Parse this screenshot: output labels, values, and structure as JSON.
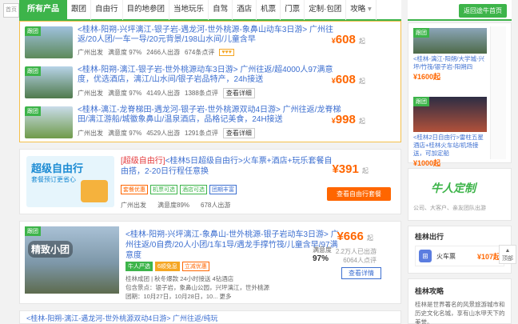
{
  "nav": {
    "side_tag": "首页",
    "all_products": "所有产品",
    "items": [
      "跟团",
      "自由行",
      "目的地参团",
      "当地玩乐",
      "自驾",
      "酒店",
      "机票",
      "门票",
      "定制·包团",
      "攻略"
    ],
    "back_home": "返回途牛首页"
  },
  "packages": [
    {
      "tag": "跟团",
      "title": "<桂林-阳朔-兴坪漓江-银子岩-遇龙河-世外桃源-象鼻山动车3日游> 广州往返/20人团/一车一导/20元背景/198山水间/儿童含早",
      "origin": "广州出发",
      "satisfaction": "满意度 97%",
      "signups": "2466人出游",
      "reviews": "674条点评",
      "detail": "查看详细",
      "price": "608",
      "qi": "起"
    },
    {
      "tag": "跟团",
      "title": "<桂林-阳朔-漓江-银子岩-世外桃源动车3日游> 广州往返/超4000人97满意度，优选酒店，漓江/山水间/银子岩品特产，24h接送",
      "origin": "广州出发",
      "satisfaction": "满意度 97%",
      "signups": "4149人出游",
      "reviews": "1388条点评",
      "detail": "查看详细",
      "price": "608",
      "qi": "起"
    },
    {
      "tag": "跟团",
      "title": "<桂林-漓江-龙脊梯田-遇龙河-银子岩-世外桃源双动4日游> 广州往返/龙脊梯田/漓江游船/城徽象鼻山/温泉酒店，品格记美食，24H接送",
      "origin": "广州出发",
      "satisfaction": "满意度 97%",
      "signups": "4529人出游",
      "reviews": "1291条点评",
      "detail": "查看详细",
      "price": "998",
      "qi": "起"
    }
  ],
  "self_guided": {
    "logo_title": "超级自由行",
    "logo_sub": "套餐预订更省心",
    "prefix": "[超级自由行]",
    "title": "<桂林5日超级自由行>火车票+酒店+玩乐套餐自由搭，2-20日行程任意换",
    "tags": [
      "套餐优惠",
      "机票可选",
      "酒店可选",
      "团期丰富"
    ],
    "origin": "广州出发",
    "satisfaction": "满意度89%",
    "signups": "678人出游",
    "price": "391",
    "qi": "起",
    "button": "查看自由行套餐"
  },
  "third": {
    "tag": "跟团",
    "caption": "精致小团",
    "title": "<桂林-阳朔-兴坪漓江-象鼻山-世外桃源-银子岩动车3日游> 广州往返/0自费/20人小团/1车1导/遇龙手撑竹筏/儿童含早/97满意度",
    "badge1": "牛人严选",
    "badge2": "6顺免息",
    "badge3": "立减优惠",
    "info1": "桂林成团 | 秋冬爆款 24小时接送 4钻酒店",
    "info2": "包含景点：银子岩，象鼻山公园，兴坪漓江，世外桃源",
    "info3": "团期：10月27日，10月28日，10... 更多",
    "price": "666",
    "qi": "起",
    "satis_label": "满意度",
    "satis_value": "97%",
    "sold1": "2.2万人已出游",
    "sold2": "6064人点评",
    "button": "查看详情"
  },
  "bottom_strip": "<桂林-阳朔-漓江-遇龙河-世外桃源双动4日游> 广州往返/纯玩",
  "sidebar": {
    "items": [
      {
        "tag": "跟团",
        "text": "<桂林-漓江-阳朔/大学城-兴坪/竹筏/银子岩-阳朔四",
        "price": "¥1600起"
      },
      {
        "tag": "跟团",
        "text": "<桂林2日自由行>雷柱五星酒店+桂林火车站/机场接送，可加定船",
        "price": "¥1000起"
      }
    ],
    "custom_logo": "牛人定制",
    "custom_sub": "公司、大客户、亲友团队出游",
    "trip_title": "桂林出行",
    "train_label": "火车票",
    "train_price": "¥107起",
    "guide_title": "桂林攻略",
    "guide_text": "桂林是世界著名的风景旅游城市和历史文化名城，享有山水甲天下的美誉。"
  },
  "totop": "顶部"
}
